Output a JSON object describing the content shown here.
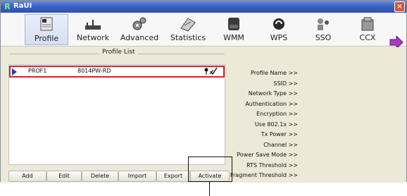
{
  "window": {
    "title": "RaUI",
    "logo": "R",
    "close": "×"
  },
  "toolbar": {
    "items": [
      {
        "label": "Profile",
        "icon": "profile-icon"
      },
      {
        "label": "Network",
        "icon": "network-icon"
      },
      {
        "label": "Advanced",
        "icon": "advanced-icon"
      },
      {
        "label": "Statistics",
        "icon": "statistics-icon"
      },
      {
        "label": "WMM",
        "icon": "wmm-icon"
      },
      {
        "label": "WPS",
        "icon": "wps-icon"
      },
      {
        "label": "SSO",
        "icon": "sso-icon"
      },
      {
        "label": "CCX",
        "icon": "ccx-icon"
      }
    ]
  },
  "profile_list": {
    "title": "Profile List",
    "rows": [
      {
        "name": "PROF1",
        "ssid": "8014PW-RD"
      }
    ]
  },
  "buttons": [
    "Add",
    "Edit",
    "Delete",
    "Import",
    "Export",
    "Activate"
  ],
  "details": [
    "Profile Name >>",
    "SSID >>",
    "Network Type >>",
    "Authentication >>",
    "Encryption >>",
    "Use 802.1x >>",
    "Tx Power >>",
    "Channel >>",
    "Power Save Mode >>",
    "RTS Threshold >>",
    "Fragment Threshold >>"
  ],
  "colors": {
    "titlebar": "#2a51b8",
    "selection_border": "#d0242a",
    "marker": "#1a3fbf",
    "panel": "#ece9d8"
  }
}
